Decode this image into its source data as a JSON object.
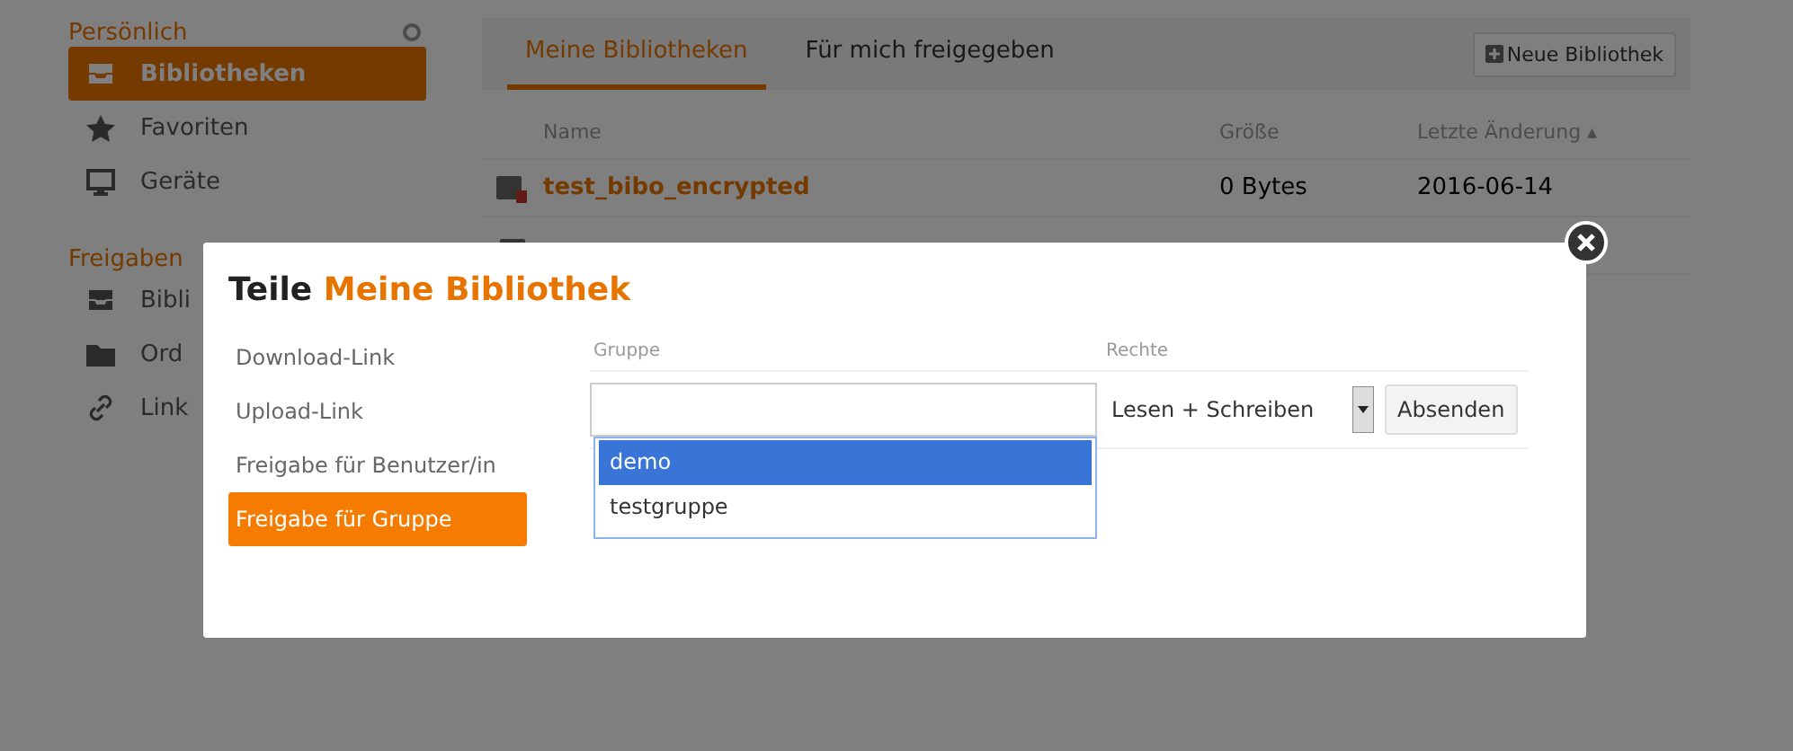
{
  "sidebar": {
    "sections": [
      {
        "title": "Persönlich",
        "items": [
          {
            "label": "Bibliotheken",
            "kind": "inbox",
            "selected": true
          },
          {
            "label": "Favoriten",
            "kind": "star",
            "selected": false
          },
          {
            "label": "Geräte",
            "kind": "monitor",
            "selected": false
          }
        ]
      },
      {
        "title": "Freigaben",
        "items": [
          {
            "label": "Bibli",
            "kind": "inbox",
            "selected": false
          },
          {
            "label": "Ord",
            "kind": "folder",
            "selected": false
          },
          {
            "label": "Link",
            "kind": "link",
            "selected": false
          }
        ]
      }
    ]
  },
  "tabs": [
    {
      "label": "Meine Bibliotheken",
      "selected": true
    },
    {
      "label": "Für mich freigegeben",
      "selected": false
    }
  ],
  "new_library_button": "Neue Bibliothek",
  "table": {
    "columns": [
      "Name",
      "Größe",
      "Letzte Änderung ▴"
    ],
    "rows": [
      {
        "name": "test_bibo_encrypted",
        "encrypted": true,
        "size": "0 Bytes",
        "modified": "2016-06-14"
      }
    ]
  },
  "dialog": {
    "title_prefix": "Teile",
    "title_name": "Meine Bibliothek",
    "nav": [
      {
        "label": "Download-Link",
        "selected": false
      },
      {
        "label": "Upload-Link",
        "selected": false
      },
      {
        "label": "Freigabe für Benutzer/in",
        "selected": false
      },
      {
        "label": "Freigabe für Gruppe",
        "selected": true
      }
    ],
    "columns": [
      "Gruppe",
      "Rechte"
    ],
    "dropdown": [
      {
        "label": "demo",
        "selected": true
      },
      {
        "label": "testgruppe",
        "selected": false
      }
    ],
    "permission": "Lesen + Schreiben",
    "submit": "Absenden"
  }
}
